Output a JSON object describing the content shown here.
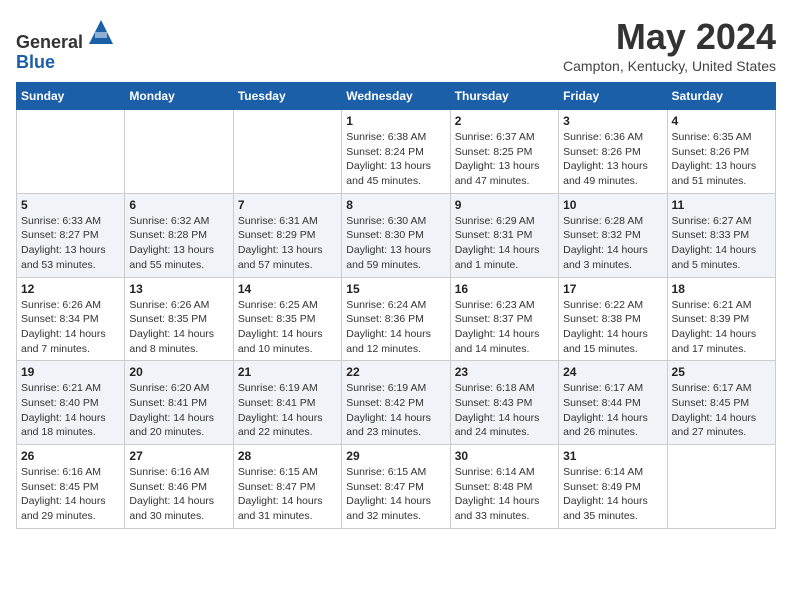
{
  "header": {
    "logo_line1": "General",
    "logo_line2": "Blue",
    "month_title": "May 2024",
    "location": "Campton, Kentucky, United States"
  },
  "weekdays": [
    "Sunday",
    "Monday",
    "Tuesday",
    "Wednesday",
    "Thursday",
    "Friday",
    "Saturday"
  ],
  "weeks": [
    [
      {
        "day": "",
        "info": ""
      },
      {
        "day": "",
        "info": ""
      },
      {
        "day": "",
        "info": ""
      },
      {
        "day": "1",
        "info": "Sunrise: 6:38 AM\nSunset: 8:24 PM\nDaylight: 13 hours\nand 45 minutes."
      },
      {
        "day": "2",
        "info": "Sunrise: 6:37 AM\nSunset: 8:25 PM\nDaylight: 13 hours\nand 47 minutes."
      },
      {
        "day": "3",
        "info": "Sunrise: 6:36 AM\nSunset: 8:26 PM\nDaylight: 13 hours\nand 49 minutes."
      },
      {
        "day": "4",
        "info": "Sunrise: 6:35 AM\nSunset: 8:26 PM\nDaylight: 13 hours\nand 51 minutes."
      }
    ],
    [
      {
        "day": "5",
        "info": "Sunrise: 6:33 AM\nSunset: 8:27 PM\nDaylight: 13 hours\nand 53 minutes."
      },
      {
        "day": "6",
        "info": "Sunrise: 6:32 AM\nSunset: 8:28 PM\nDaylight: 13 hours\nand 55 minutes."
      },
      {
        "day": "7",
        "info": "Sunrise: 6:31 AM\nSunset: 8:29 PM\nDaylight: 13 hours\nand 57 minutes."
      },
      {
        "day": "8",
        "info": "Sunrise: 6:30 AM\nSunset: 8:30 PM\nDaylight: 13 hours\nand 59 minutes."
      },
      {
        "day": "9",
        "info": "Sunrise: 6:29 AM\nSunset: 8:31 PM\nDaylight: 14 hours\nand 1 minute."
      },
      {
        "day": "10",
        "info": "Sunrise: 6:28 AM\nSunset: 8:32 PM\nDaylight: 14 hours\nand 3 minutes."
      },
      {
        "day": "11",
        "info": "Sunrise: 6:27 AM\nSunset: 8:33 PM\nDaylight: 14 hours\nand 5 minutes."
      }
    ],
    [
      {
        "day": "12",
        "info": "Sunrise: 6:26 AM\nSunset: 8:34 PM\nDaylight: 14 hours\nand 7 minutes."
      },
      {
        "day": "13",
        "info": "Sunrise: 6:26 AM\nSunset: 8:35 PM\nDaylight: 14 hours\nand 8 minutes."
      },
      {
        "day": "14",
        "info": "Sunrise: 6:25 AM\nSunset: 8:35 PM\nDaylight: 14 hours\nand 10 minutes."
      },
      {
        "day": "15",
        "info": "Sunrise: 6:24 AM\nSunset: 8:36 PM\nDaylight: 14 hours\nand 12 minutes."
      },
      {
        "day": "16",
        "info": "Sunrise: 6:23 AM\nSunset: 8:37 PM\nDaylight: 14 hours\nand 14 minutes."
      },
      {
        "day": "17",
        "info": "Sunrise: 6:22 AM\nSunset: 8:38 PM\nDaylight: 14 hours\nand 15 minutes."
      },
      {
        "day": "18",
        "info": "Sunrise: 6:21 AM\nSunset: 8:39 PM\nDaylight: 14 hours\nand 17 minutes."
      }
    ],
    [
      {
        "day": "19",
        "info": "Sunrise: 6:21 AM\nSunset: 8:40 PM\nDaylight: 14 hours\nand 18 minutes."
      },
      {
        "day": "20",
        "info": "Sunrise: 6:20 AM\nSunset: 8:41 PM\nDaylight: 14 hours\nand 20 minutes."
      },
      {
        "day": "21",
        "info": "Sunrise: 6:19 AM\nSunset: 8:41 PM\nDaylight: 14 hours\nand 22 minutes."
      },
      {
        "day": "22",
        "info": "Sunrise: 6:19 AM\nSunset: 8:42 PM\nDaylight: 14 hours\nand 23 minutes."
      },
      {
        "day": "23",
        "info": "Sunrise: 6:18 AM\nSunset: 8:43 PM\nDaylight: 14 hours\nand 24 minutes."
      },
      {
        "day": "24",
        "info": "Sunrise: 6:17 AM\nSunset: 8:44 PM\nDaylight: 14 hours\nand 26 minutes."
      },
      {
        "day": "25",
        "info": "Sunrise: 6:17 AM\nSunset: 8:45 PM\nDaylight: 14 hours\nand 27 minutes."
      }
    ],
    [
      {
        "day": "26",
        "info": "Sunrise: 6:16 AM\nSunset: 8:45 PM\nDaylight: 14 hours\nand 29 minutes."
      },
      {
        "day": "27",
        "info": "Sunrise: 6:16 AM\nSunset: 8:46 PM\nDaylight: 14 hours\nand 30 minutes."
      },
      {
        "day": "28",
        "info": "Sunrise: 6:15 AM\nSunset: 8:47 PM\nDaylight: 14 hours\nand 31 minutes."
      },
      {
        "day": "29",
        "info": "Sunrise: 6:15 AM\nSunset: 8:47 PM\nDaylight: 14 hours\nand 32 minutes."
      },
      {
        "day": "30",
        "info": "Sunrise: 6:14 AM\nSunset: 8:48 PM\nDaylight: 14 hours\nand 33 minutes."
      },
      {
        "day": "31",
        "info": "Sunrise: 6:14 AM\nSunset: 8:49 PM\nDaylight: 14 hours\nand 35 minutes."
      },
      {
        "day": "",
        "info": ""
      }
    ]
  ]
}
